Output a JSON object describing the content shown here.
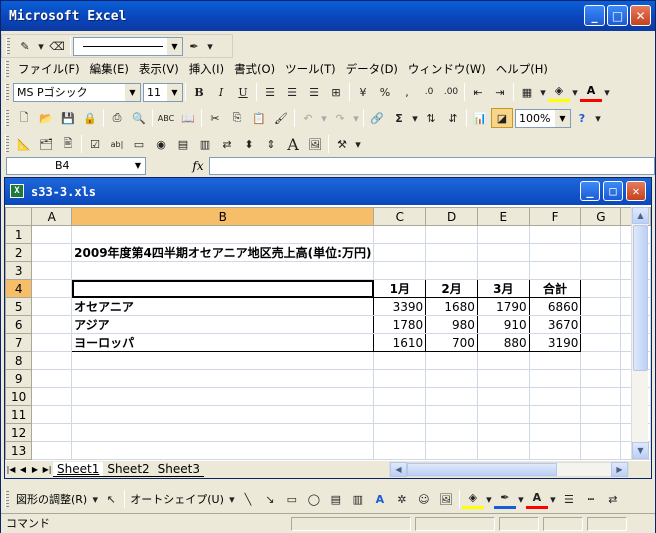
{
  "window": {
    "title": "Microsoft Excel",
    "min": "_",
    "max": "□",
    "close": "✕"
  },
  "menu": [
    "ファイル(F)",
    "編集(E)",
    "表示(V)",
    "挿入(I)",
    "書式(O)",
    "ツール(T)",
    "データ(D)",
    "ウィンドウ(W)",
    "ヘルプ(H)"
  ],
  "font": {
    "name": "MS Pゴシック",
    "size": "11"
  },
  "zoom": "100%",
  "namebox": "B4",
  "fx": "fx",
  "workbook": {
    "title": "s33-3.xls",
    "icon": "X"
  },
  "columns": [
    "A",
    "B",
    "C",
    "D",
    "E",
    "F",
    "G",
    "H"
  ],
  "rows": [
    "1",
    "2",
    "3",
    "4",
    "5",
    "6",
    "7",
    "8",
    "9",
    "10",
    "11",
    "12",
    "13"
  ],
  "sheet": {
    "title": "2009年度第4四半期オセアニア地区売上高(単位:万円)",
    "headers": [
      "1月",
      "2月",
      "3月",
      "合計"
    ],
    "data": [
      {
        "region": "オセアニア",
        "m1": "3390",
        "m2": "1680",
        "m3": "1790",
        "total": "6860"
      },
      {
        "region": "アジア",
        "m1": "1780",
        "m2": "980",
        "m3": "910",
        "total": "3670"
      },
      {
        "region": "ヨーロッパ",
        "m1": "1610",
        "m2": "700",
        "m3": "880",
        "total": "3190"
      }
    ]
  },
  "tabs": [
    "Sheet1",
    "Sheet2",
    "Sheet3"
  ],
  "drawing": {
    "adjust": "図形の調整(R)",
    "autoshape": "オートシェイプ(U)"
  },
  "status": "コマンド",
  "colors": {
    "title_blue": "#0a43b8",
    "selected_header": "#f7be6a",
    "toolbar_bg": "#ece9d8"
  }
}
